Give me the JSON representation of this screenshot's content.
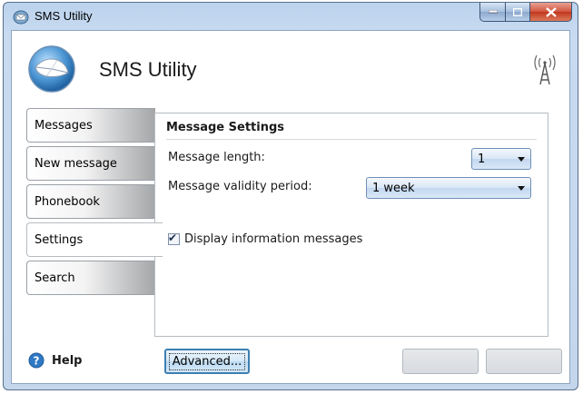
{
  "window": {
    "title": "SMS Utility"
  },
  "header": {
    "app_title": "SMS Utility",
    "logo_icon": "envelope-globe-icon",
    "signal_icon": "antenna-icon"
  },
  "nav": {
    "items": [
      {
        "label": "Messages",
        "active": false
      },
      {
        "label": "New message",
        "active": false
      },
      {
        "label": "Phonebook",
        "active": false
      },
      {
        "label": "Settings",
        "active": true
      },
      {
        "label": "Search",
        "active": false
      }
    ]
  },
  "settings": {
    "group_title": "Message Settings",
    "message_length": {
      "label": "Message length:",
      "value": "1"
    },
    "validity_period": {
      "label": "Message validity period:",
      "value": "1 week"
    },
    "display_info": {
      "label": "Display information messages",
      "checked": true
    }
  },
  "footer": {
    "help_label": "Help",
    "advanced_label": "Advanced..."
  },
  "colors": {
    "accent": "#3c7fb1",
    "help_icon": "#2f78c4",
    "close_button": "#c0361d"
  }
}
